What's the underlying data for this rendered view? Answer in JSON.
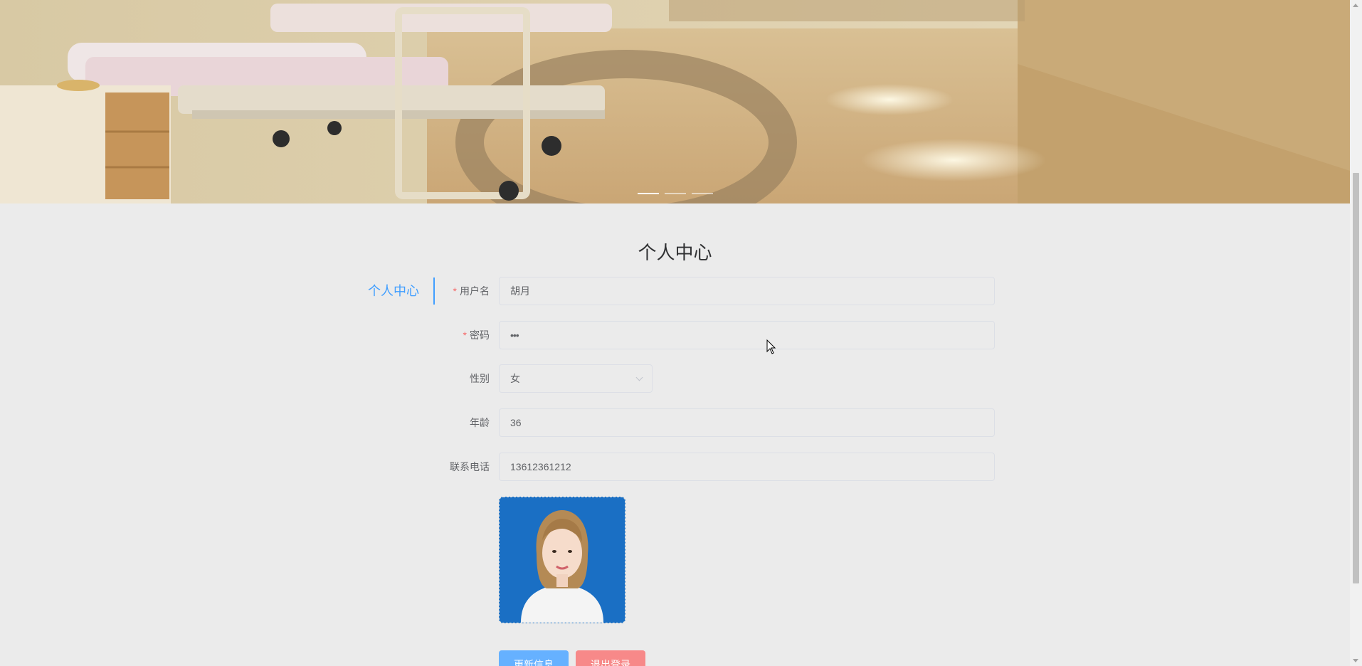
{
  "page": {
    "title": "个人中心"
  },
  "side_nav": {
    "active_tab": "个人中心"
  },
  "carousel": {
    "slide_count": 3,
    "active_index": 0
  },
  "form": {
    "username": {
      "label": "用户名",
      "value": "胡月",
      "required": true
    },
    "password": {
      "label": "密码",
      "value": "•••",
      "required": true
    },
    "gender": {
      "label": "性别",
      "value": "女"
    },
    "age": {
      "label": "年龄",
      "value": "36"
    },
    "phone": {
      "label": "联系电话",
      "value": "13612361212"
    }
  },
  "buttons": {
    "update": "更新信息",
    "logout": "退出登录"
  },
  "colors": {
    "accent": "#409eff",
    "required": "#f56c6c",
    "primary_button": "#66b1ff",
    "danger_button": "#f78989",
    "background": "#ebebeb"
  }
}
